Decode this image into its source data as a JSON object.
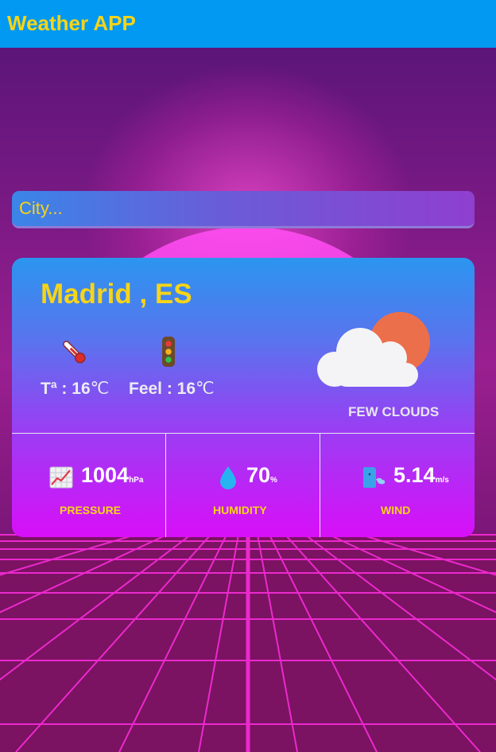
{
  "appbar": {
    "title": "Weather APP"
  },
  "search": {
    "placeholder": "City..."
  },
  "weather": {
    "location": "Madrid , ES",
    "temp_label": "Tª : 16",
    "temp_unit": "℃",
    "feel_label": "Feel : 16",
    "feel_unit": "℃",
    "description": "FEW CLOUDS",
    "condition_icon": "few-clouds-icon"
  },
  "stats": {
    "pressure": {
      "value": "1004",
      "unit": "hPa",
      "label": "PRESSURE",
      "icon": "chart-icon"
    },
    "humidity": {
      "value": "70",
      "unit": "%",
      "label": "HUMIDITY",
      "icon": "droplet-icon"
    },
    "wind": {
      "value": "5.14",
      "unit": "m/s",
      "label": "WIND",
      "icon": "wind-face-icon"
    }
  },
  "colors": {
    "appbar": "#0299f2",
    "accent_yellow": "#f7d417"
  }
}
